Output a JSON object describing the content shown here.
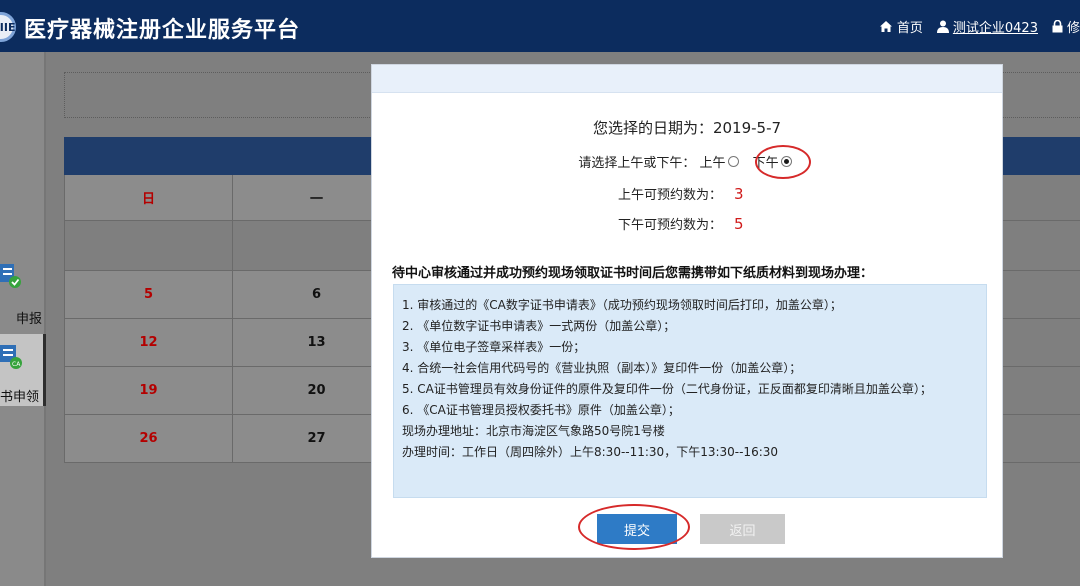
{
  "header": {
    "logo_text": "NIIIE",
    "title": "医疗器械注册企业服务平台",
    "nav": [
      {
        "label": "首页",
        "icon": "home-icon"
      },
      {
        "label": "测试企业0423",
        "icon": "user-icon"
      },
      {
        "label": "修",
        "icon": "lock-icon"
      }
    ]
  },
  "sidebar": {
    "items": [
      {
        "label": "申报",
        "icon": "document-check-icon"
      },
      {
        "label": "书申领",
        "icon": "ca-certificate-icon"
      }
    ]
  },
  "calendar": {
    "weekday_headers": [
      "日",
      "一"
    ],
    "rows": [
      [],
      [
        "5",
        "6"
      ],
      [
        "12",
        "13"
      ],
      [
        "19",
        "20"
      ],
      [
        "26",
        "27"
      ]
    ]
  },
  "modal": {
    "date_label": "您选择的日期为：",
    "date_value": "2019-5-7",
    "ampm_label": "请选择上午或下午：",
    "am_label": "上午",
    "pm_label": "下午",
    "am_count_label": "上午可预约数为：",
    "am_count": "3",
    "pm_count_label": "下午可预约数为：",
    "pm_count": "5",
    "notice": "待中心审核通过并成功预约现场领取证书时间后您需携带如下纸质材料到现场办理：",
    "materials": [
      "1. 审核通过的《CA数字证书申请表》（成功预约现场领取时间后打印，加盖公章）；",
      "2. 《单位数字证书申请表》一式两份（加盖公章）；",
      "3. 《单位电子签章采样表》一份；",
      "4. 合统一社会信用代码号的《营业执照（副本）》复印件一份（加盖公章）；",
      "5. CA证书管理员有效身份证件的原件及复印件一份（二代身份证，正反面都复印清晰且加盖公章）；",
      "6. 《CA证书管理员授权委托书》原件（加盖公章）；",
      "现场办理地址：北京市海淀区气象路50号院1号楼",
      "办理时间：工作日（周四除外）上午8:30--11:30，下午13:30--16:30"
    ],
    "submit_label": "提交",
    "back_label": "返回",
    "colors": {
      "submit": "#2e7bc6",
      "count": "#d01b1b",
      "annotation": "#d62a2a"
    }
  }
}
